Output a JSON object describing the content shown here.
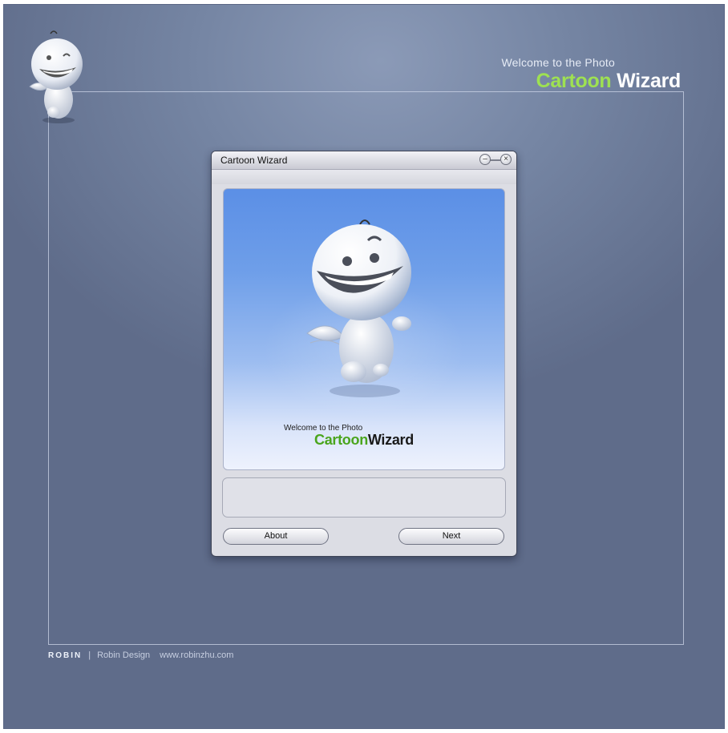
{
  "page": {
    "header": {
      "subtitle": "Welcome to the Photo",
      "title_part1": "Cartoon",
      "title_part2": "Wizard"
    },
    "footer": {
      "brand": "ROBIN",
      "separator": "|",
      "company": "Robin Design",
      "website": "www.robinzhu.com"
    },
    "mascot_icon": "angel-mascot-icon"
  },
  "window": {
    "title": "Cartoon Wizard",
    "controls": {
      "minimize_glyph": "–",
      "close_glyph": "×"
    },
    "banner": {
      "subtitle": "Welcome to the Photo",
      "title_part1": "Cartoon",
      "title_part2": "Wizard"
    },
    "info_text": "",
    "buttons": {
      "about_label": "About",
      "next_label": "Next"
    }
  },
  "colors": {
    "background": "#7585a3",
    "accent_green": "#9ee152",
    "banner_green": "#4aa51d",
    "banner_blue": "#5b8fe6"
  }
}
